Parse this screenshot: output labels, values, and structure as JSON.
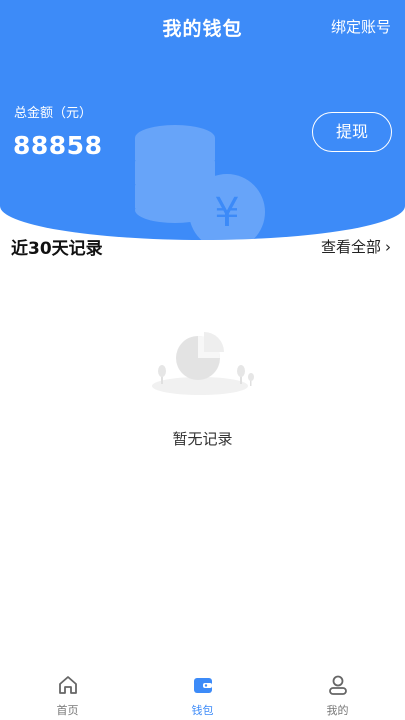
{
  "header": {
    "title": "我的钱包",
    "bind_account": "绑定账号",
    "balance_label": "总金额（元）",
    "balance_value": "88858",
    "withdraw_label": "提现"
  },
  "records": {
    "section_title": "近30天记录",
    "view_all": "查看全部",
    "empty_text": "暂无记录"
  },
  "tabbar": {
    "items": [
      {
        "label": "首页",
        "icon": "home-icon",
        "active": false
      },
      {
        "label": "钱包",
        "icon": "wallet-icon",
        "active": true
      },
      {
        "label": "我的",
        "icon": "user-icon",
        "active": false
      }
    ]
  },
  "colors": {
    "primary": "#3d8bf8",
    "tab_inactive": "#777777"
  }
}
